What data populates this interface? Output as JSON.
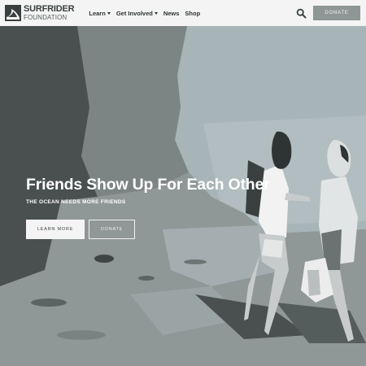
{
  "brand": {
    "name_line1": "SURFRIDER",
    "name_line2": "FOUNDATION",
    "logo_icon": "surfrider-wave-icon"
  },
  "nav": {
    "items": [
      {
        "label": "Learn",
        "has_dropdown": true
      },
      {
        "label": "Get Involved",
        "has_dropdown": true
      },
      {
        "label": "News",
        "has_dropdown": false
      },
      {
        "label": "Shop",
        "has_dropdown": false
      }
    ],
    "search_icon": "search-icon",
    "donate_label": "DONATE"
  },
  "hero": {
    "title": "Friends Show Up For Each Other",
    "subtitle": "THE OCEAN NEEDS MORE FRIENDS",
    "primary_button": "LEARN MORE",
    "secondary_button": "DONATE"
  },
  "colors": {
    "header_bg": "#f4f4f4",
    "donate_bg": "#8e9696",
    "text_dark": "#2d3232"
  }
}
